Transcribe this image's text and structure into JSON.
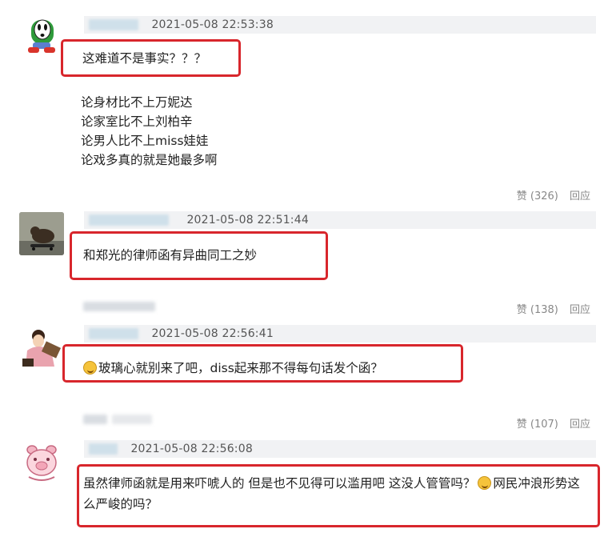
{
  "comments": [
    {
      "timestamp": "2021-05-08 22:53:38",
      "lines": [
        "这难道不是事实？？？",
        "论身材比不上万妮达",
        "论家室比不上刘柏辛",
        "论男人比不上miss娃娃",
        "论戏多真的就是她最多啊"
      ],
      "likes": "赞 (326)",
      "reply": "回应"
    },
    {
      "timestamp": "2021-05-08 22:51:44",
      "lines": [
        "和郑光的律师函有异曲同工之妙"
      ],
      "likes": "赞 (138)",
      "reply": "回应"
    },
    {
      "timestamp": "2021-05-08 22:56:41",
      "lines": [
        "玻璃心就别来了吧，diss起来那不得每句话发个函？"
      ],
      "likes": "赞 (107)",
      "reply": "回应"
    },
    {
      "timestamp": "2021-05-08 22:56:08",
      "lines": [
        "虽然律师函就是用来吓唬人的 但是也不见得可以滥用吧 这没人管管吗？",
        "网民冲浪形势这",
        "么严峻的吗？"
      ]
    }
  ],
  "colors": {
    "highlight": "#d8262c",
    "meta_bg": "#f1f2f4"
  },
  "icons": [
    "shy-guy-avatar",
    "skateboard-dog-avatar",
    "cartoon-girl-avatar",
    "pig-avatar",
    "smile-emoji"
  ]
}
